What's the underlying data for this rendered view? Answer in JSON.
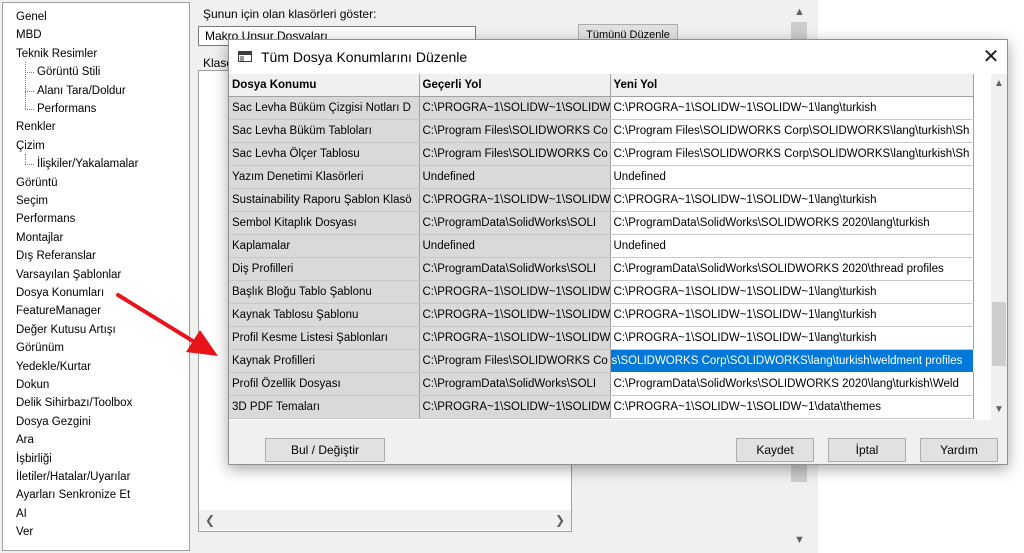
{
  "options_tree": {
    "items": [
      {
        "label": "Genel",
        "level": 0
      },
      {
        "label": "MBD",
        "level": 0
      },
      {
        "label": "Teknik Resimler",
        "level": 0
      },
      {
        "label": "Görüntü Stili",
        "level": 1
      },
      {
        "label": "Alanı Tara/Doldur",
        "level": 1
      },
      {
        "label": "Performans",
        "level": 1
      },
      {
        "label": "Renkler",
        "level": 0
      },
      {
        "label": "Çizim",
        "level": 0
      },
      {
        "label": "İlişkiler/Yakalamalar",
        "level": 1
      },
      {
        "label": "Görüntü",
        "level": 0
      },
      {
        "label": "Seçim",
        "level": 0
      },
      {
        "label": "Performans",
        "level": 0
      },
      {
        "label": "Montajlar",
        "level": 0
      },
      {
        "label": "Dış Referanslar",
        "level": 0
      },
      {
        "label": "Varsayılan Şablonlar",
        "level": 0
      },
      {
        "label": "Dosya Konumları",
        "level": 0
      },
      {
        "label": "FeatureManager",
        "level": 0
      },
      {
        "label": "Değer Kutusu Artışı",
        "level": 0
      },
      {
        "label": "Görünüm",
        "level": 0
      },
      {
        "label": "Yedekle/Kurtar",
        "level": 0
      },
      {
        "label": "Dokun",
        "level": 0
      },
      {
        "label": "Delik Sihirbazı/Toolbox",
        "level": 0
      },
      {
        "label": "Dosya Gezgini",
        "level": 0
      },
      {
        "label": "Ara",
        "level": 0
      },
      {
        "label": "İşbirliği",
        "level": 0
      },
      {
        "label": "İletiler/Hatalar/Uyarılar",
        "level": 0
      },
      {
        "label": "Ayarları Senkronize Et",
        "level": 0
      },
      {
        "label": "AI",
        "level": 0
      },
      {
        "label": "Ver",
        "level": 0
      }
    ]
  },
  "options_panel": {
    "show_folders_label": "Şunun için olan klasörleri göster:",
    "folder_type_value": "Makro Unsur Dosyaları",
    "edit_all_label": "Tümünü Düzenle",
    "folders_label": "Klasö"
  },
  "dialog": {
    "title": "Tüm Dosya Konumlarını Düzenle",
    "columns": [
      "Dosya Konumu",
      "Geçerli Yol",
      "Yeni Yol"
    ],
    "rows": [
      {
        "location": "Sac Levha Büküm Çizgisi Notları D",
        "current": "C:\\PROGRA~1\\SOLIDW~1\\SOLIDW",
        "new": "C:\\PROGRA~1\\SOLIDW~1\\SOLIDW~1\\lang\\turkish"
      },
      {
        "location": "Sac Levha Büküm Tabloları",
        "current": "C:\\Program Files\\SOLIDWORKS Co",
        "new": "C:\\Program Files\\SOLIDWORKS Corp\\SOLIDWORKS\\lang\\turkish\\Sh"
      },
      {
        "location": "Sac Levha Ölçer Tablosu",
        "current": "C:\\Program Files\\SOLIDWORKS Co",
        "new": "C:\\Program Files\\SOLIDWORKS Corp\\SOLIDWORKS\\lang\\turkish\\Sh"
      },
      {
        "location": "Yazım Denetimi Klasörleri",
        "current": "Undefined",
        "new": "Undefined"
      },
      {
        "location": "Sustainability Raporu Şablon Klasö",
        "current": "C:\\PROGRA~1\\SOLIDW~1\\SOLIDW",
        "new": "C:\\PROGRA~1\\SOLIDW~1\\SOLIDW~1\\lang\\turkish"
      },
      {
        "location": "Sembol Kitaplık Dosyası",
        "current": "C:\\ProgramData\\SolidWorks\\SOLI",
        "new": "C:\\ProgramData\\SolidWorks\\SOLIDWORKS 2020\\lang\\turkish"
      },
      {
        "location": "Kaplamalar",
        "current": "Undefined",
        "new": "Undefined"
      },
      {
        "location": "Diş Profilleri",
        "current": "C:\\ProgramData\\SolidWorks\\SOLI",
        "new": "C:\\ProgramData\\SolidWorks\\SOLIDWORKS 2020\\thread profiles"
      },
      {
        "location": "Başlık Bloğu Tablo Şablonu",
        "current": "C:\\PROGRA~1\\SOLIDW~1\\SOLIDW",
        "new": "C:\\PROGRA~1\\SOLIDW~1\\SOLIDW~1\\lang\\turkish"
      },
      {
        "location": "Kaynak Tablosu Şablonu",
        "current": "C:\\PROGRA~1\\SOLIDW~1\\SOLIDW",
        "new": "C:\\PROGRA~1\\SOLIDW~1\\SOLIDW~1\\lang\\turkish"
      },
      {
        "location": "Profil Kesme Listesi Şablonları",
        "current": "C:\\PROGRA~1\\SOLIDW~1\\SOLIDW",
        "new": "C:\\PROGRA~1\\SOLIDW~1\\SOLIDW~1\\lang\\turkish"
      },
      {
        "location": "Kaynak Profilleri",
        "current": "C:\\Program Files\\SOLIDWORKS Co",
        "new": "s\\SOLIDWORKS Corp\\SOLIDWORKS\\lang\\turkish\\weldment profiles",
        "selected": true
      },
      {
        "location": "Profil Özellik Dosyası",
        "current": "C:\\ProgramData\\SolidWorks\\SOLI",
        "new": "C:\\ProgramData\\SolidWorks\\SOLIDWORKS 2020\\lang\\turkish\\Weld"
      },
      {
        "location": "3D PDF Temaları",
        "current": "C:\\PROGRA~1\\SOLIDW~1\\SOLIDW",
        "new": "C:\\PROGRA~1\\SOLIDW~1\\SOLIDW~1\\data\\themes"
      }
    ],
    "find_replace_label": "Bul / Değiştir",
    "save_label": "Kaydet",
    "cancel_label": "İptal",
    "help_label": "Yardım"
  },
  "colors": {
    "selection": "#0078d7",
    "arrow": "#e8141b"
  }
}
